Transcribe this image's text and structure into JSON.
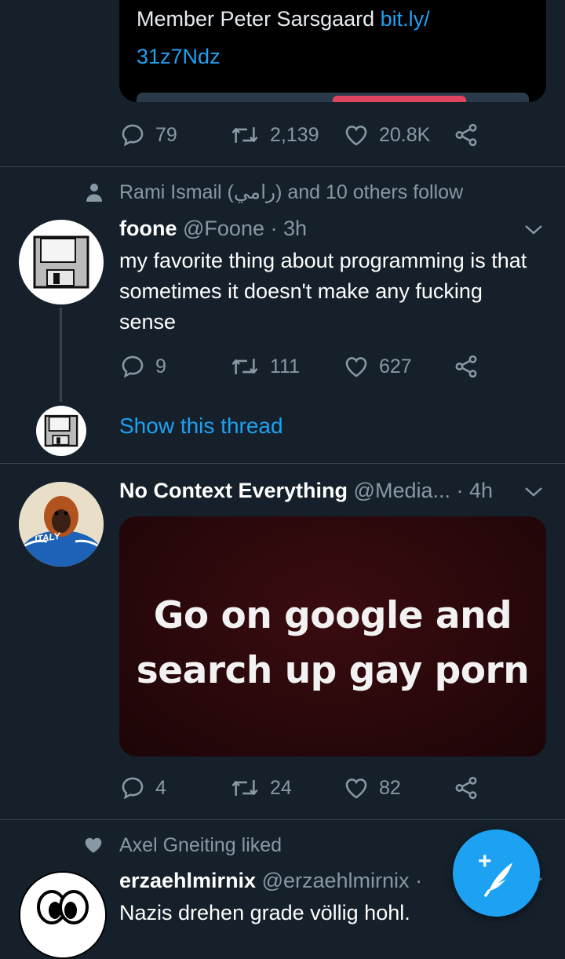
{
  "colors": {
    "background": "#15202b",
    "muted": "#8899a6",
    "accent": "#1da1f2",
    "divider": "#38444d"
  },
  "tweet0": {
    "card_line1": "Member Peter Sarsgaard ",
    "card_link1": "bit.ly/",
    "card_link2": "31z7Ndz",
    "replies": "79",
    "retweets": "2,139",
    "likes": "20.8K"
  },
  "tweet1": {
    "social_context": "Rami Ismail (رامي) and 10 others follow",
    "name": "foone",
    "handle": "@Foone",
    "time": "· 3h",
    "text": "my favorite thing about programming is that sometimes it doesn't make any fucking sense",
    "replies": "9",
    "retweets": "111",
    "likes": "627",
    "show_thread": "Show this thread"
  },
  "tweet2": {
    "name": "No Context Everything",
    "handle": "@Media...",
    "time": "· 4h",
    "avatar_text": "ITALY",
    "image_text_line1": "Go  on google and",
    "image_text_line2": "search up gay porn",
    "replies": "4",
    "retweets": "24",
    "likes": "82"
  },
  "tweet3": {
    "social_context": "Axel Gneiting liked",
    "name": "erzaehlmirnix",
    "handle": "@erzaehlmirnix",
    "time": "·",
    "text": "Nazis drehen grade völlig hohl."
  },
  "fab": {
    "icon": "compose-tweet-icon",
    "plus": "+"
  }
}
